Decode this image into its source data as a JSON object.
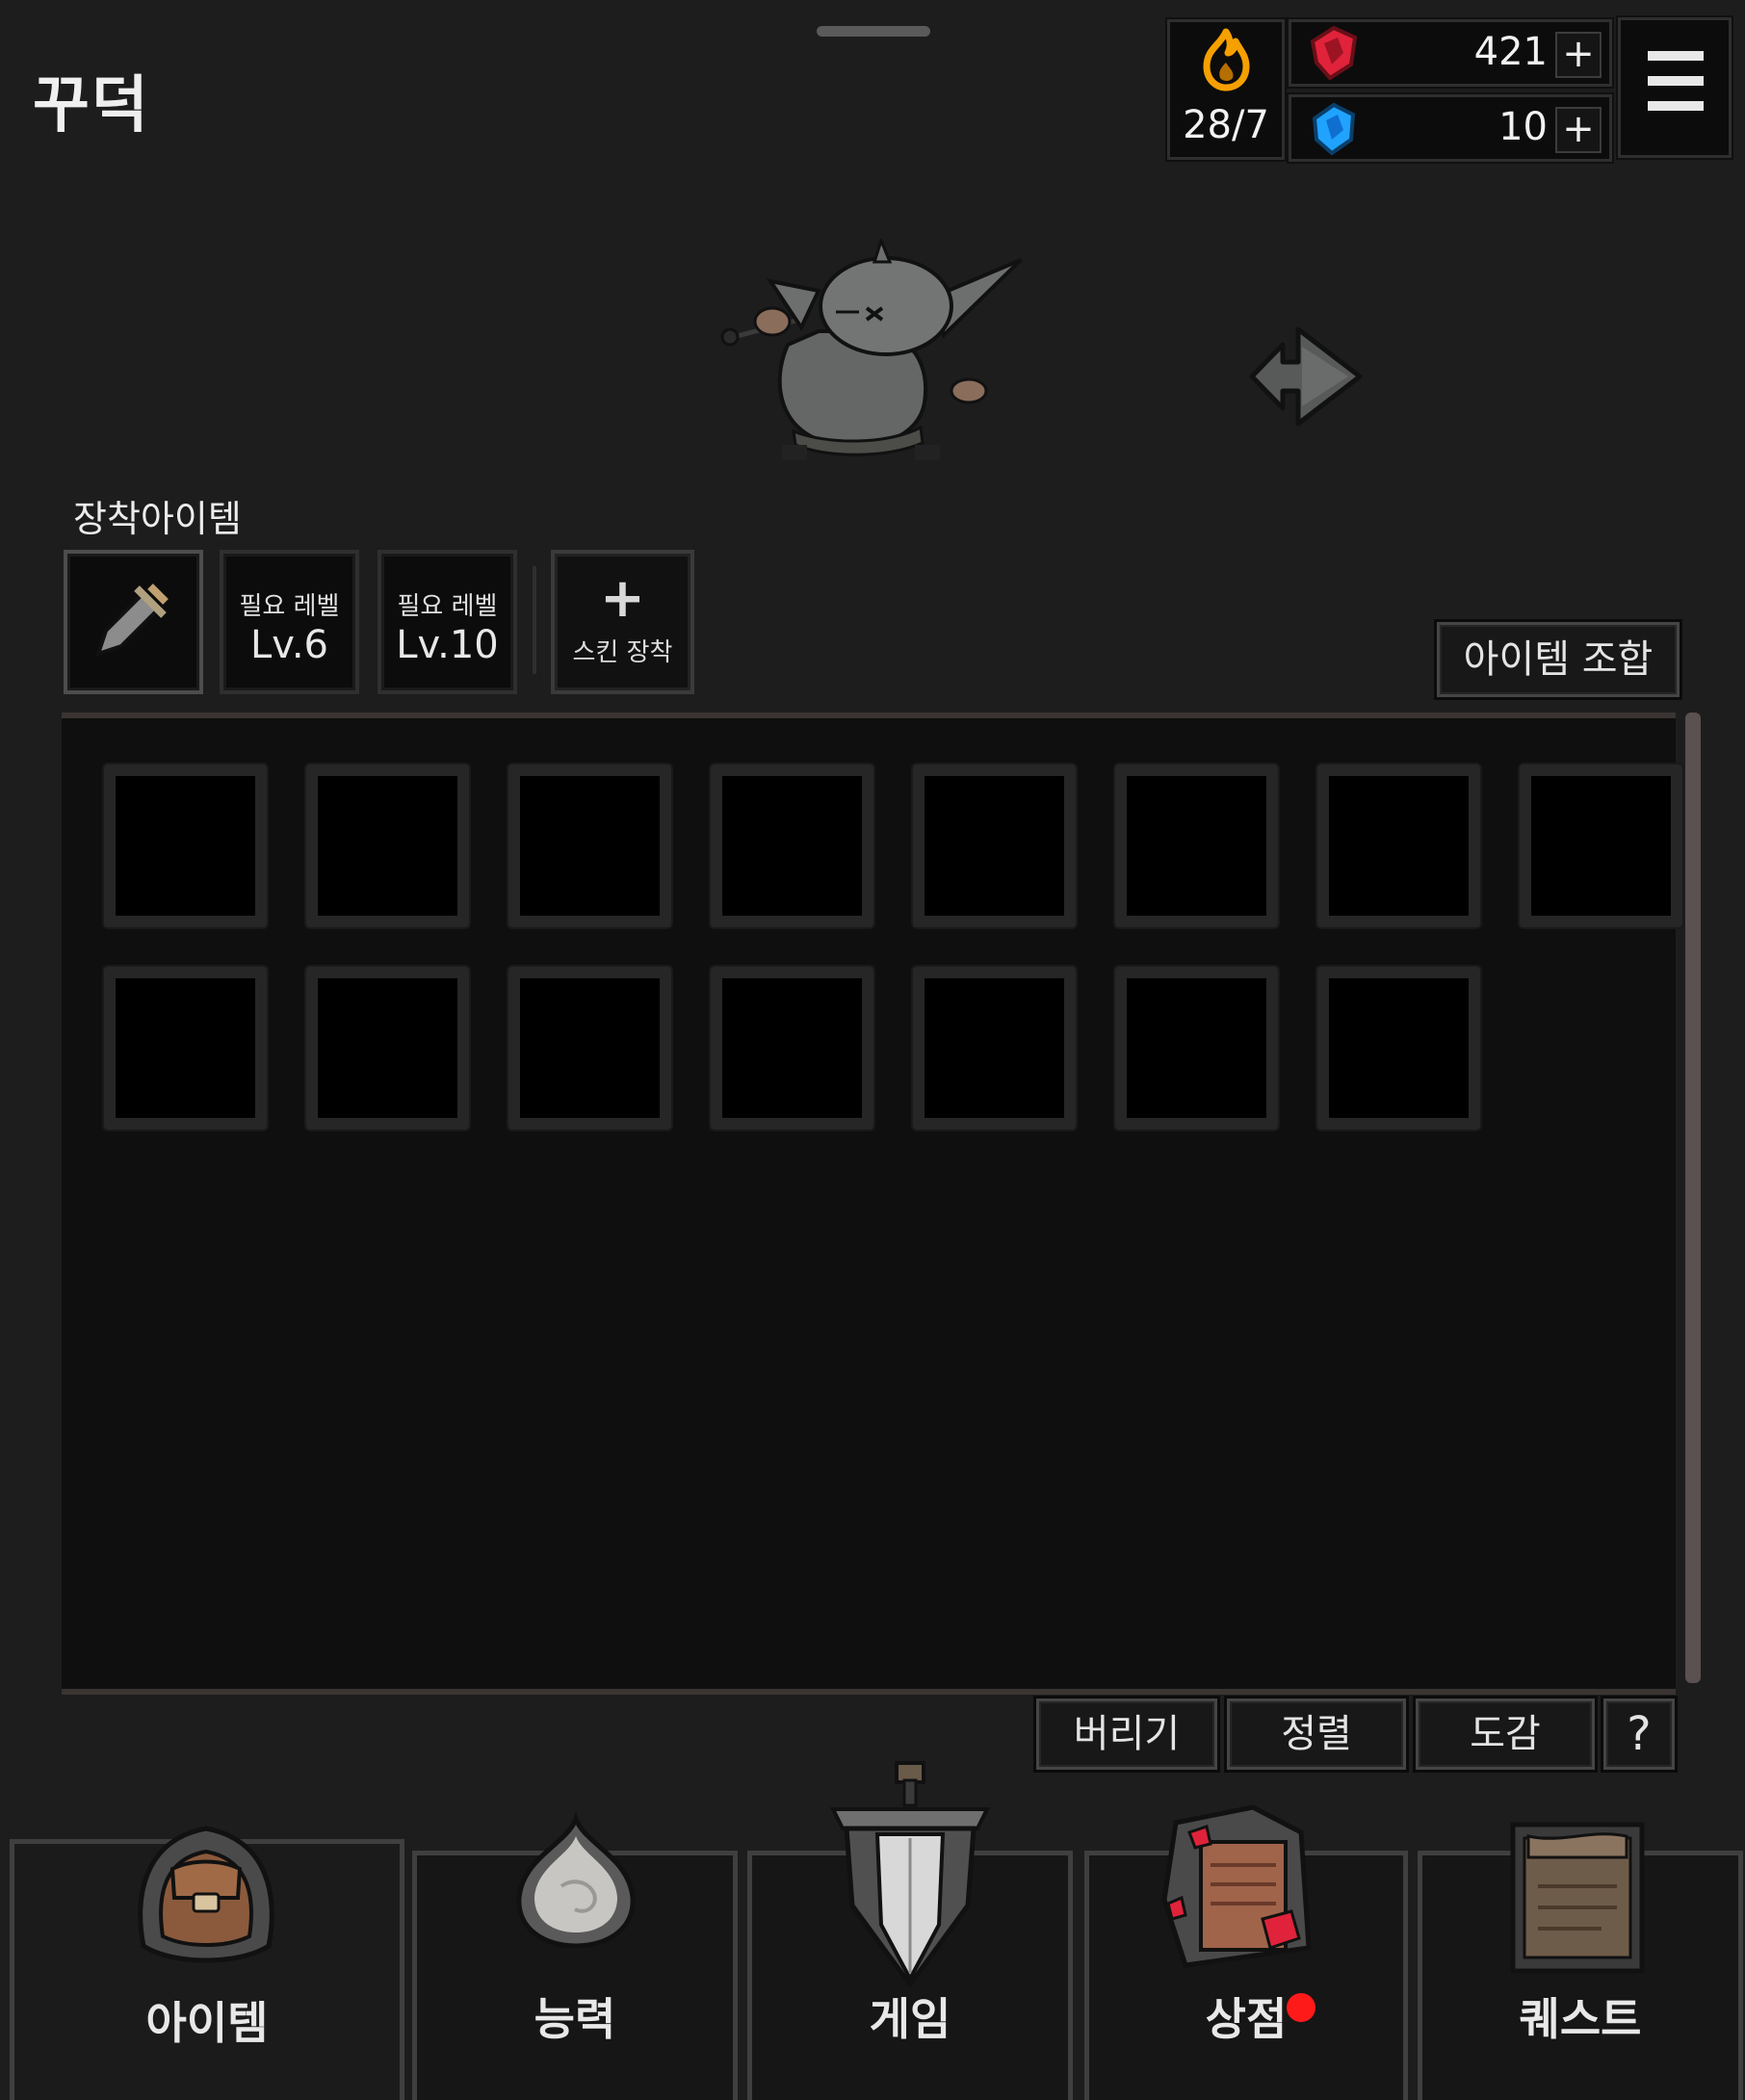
{
  "header": {
    "player_name": "꾸덕"
  },
  "resources": {
    "stamina": {
      "icon": "flame-icon",
      "value": "28/7",
      "color": "#f5a000"
    },
    "red_gem": {
      "icon": "red-gem-icon",
      "amount": "421",
      "add": "+",
      "color": "#e0233a"
    },
    "blue_gem": {
      "icon": "blue-gem-icon",
      "amount": "10",
      "add": "+",
      "color": "#1fa3ff"
    }
  },
  "equipment": {
    "title": "장착아이템",
    "slots": [
      {
        "type": "weapon",
        "icon": "sword-icon"
      },
      {
        "required": "필요 레벨",
        "level": "Lv.6"
      },
      {
        "required": "필요 레벨",
        "level": "Lv.10"
      }
    ],
    "skin": {
      "plus": "+",
      "label": "스킨 장착"
    }
  },
  "combine_button": "아이템 조합",
  "inventory": {
    "slot_count": 15
  },
  "actions": {
    "discard": "버리기",
    "sort": "정렬",
    "collection": "도감",
    "help": "?"
  },
  "bottom_nav": [
    {
      "label": "아이템",
      "icon": "backpack-icon",
      "active": true
    },
    {
      "label": "능력",
      "icon": "onion-icon"
    },
    {
      "label": "게임",
      "icon": "sword-banner-icon"
    },
    {
      "label": "상점",
      "icon": "shop-scroll-icon",
      "notification": true
    },
    {
      "label": "퀘스트",
      "icon": "quest-scroll-icon"
    }
  ]
}
